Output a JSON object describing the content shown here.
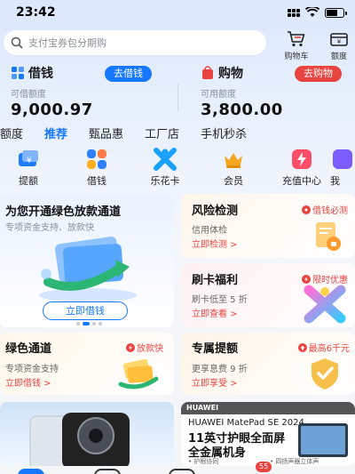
{
  "status_bar": {
    "time": "23:42"
  },
  "search": {
    "placeholder": "支付宝券包分期购"
  },
  "top_actions": [
    {
      "label": "购物车",
      "icon": "cart-icon"
    },
    {
      "label": "额度",
      "icon": "wallet-icon"
    }
  ],
  "accounts": {
    "borrow": {
      "title": "借钱",
      "button": "去借钱",
      "label": "可借额度",
      "amount": "9,000.97",
      "color": "#1677ff"
    },
    "shop": {
      "title": "购物",
      "button": "去购物",
      "label": "可用额度",
      "amount": "3,800.00",
      "color": "#e8433f"
    }
  },
  "category_tabs": [
    "额度",
    "推荐",
    "甄品惠",
    "工厂店",
    "手机秒杀"
  ],
  "grid_items": [
    {
      "label": "提额",
      "icon": "raise-limit-icon"
    },
    {
      "label": "借钱",
      "icon": "borrow-grid-icon"
    },
    {
      "label": "乐花卡",
      "icon": "lehua-card-icon"
    },
    {
      "label": "会员",
      "icon": "member-crown-icon"
    },
    {
      "label": "充值中心",
      "icon": "recharge-icon"
    },
    {
      "label": "我",
      "icon": "more-icon"
    }
  ],
  "promo_main": {
    "title": "为您开通绿色放款通道",
    "sub": "专项资金支持、放款快",
    "button": "立即借钱"
  },
  "risk_card": {
    "title": "风险检测",
    "tag": "借钱必测",
    "sub": "信用体检",
    "link": "立即检测 >"
  },
  "swipe_card": {
    "title": "刷卡福利",
    "tag": "限时优惠",
    "sub": "刷卡低至 5 折",
    "link": "立即查看 >"
  },
  "green_card": {
    "title": "绿色通道",
    "tag": "放款快",
    "sub": "专项资金支持",
    "link": "立即借钱 >"
  },
  "withdraw_card": {
    "title": "专属提额",
    "tag": "最高6千元",
    "sub": "更享息费 9 折",
    "link": "立即享受 >"
  },
  "ad_right": {
    "brand": "HUAWEI",
    "product": "HUAWEI MatePad SE 2024",
    "line1": "11英寸护眼全面屏",
    "line2": "全金属机身",
    "feature1": "• 护眼协同",
    "feature2": "• 四扬声器立体声"
  },
  "bottom_badge": "55",
  "colors": {
    "accent_blue": "#1677ff",
    "accent_red": "#e8433f"
  }
}
